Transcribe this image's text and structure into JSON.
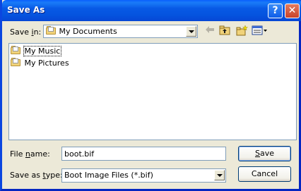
{
  "window": {
    "title": "Save As"
  },
  "titlebar": {
    "help_label": "?",
    "close_label": "✕"
  },
  "save_in": {
    "label_pre": "Save ",
    "label_key": "i",
    "label_post": "n:",
    "value": "My Documents"
  },
  "toolbar": {
    "back_icon": "back-arrow-icon",
    "up_icon": "up-folder-icon",
    "new_folder_icon": "new-folder-icon",
    "views_icon": "views-menu-icon"
  },
  "files": [
    {
      "name": "My Music",
      "icon": "folder-icon",
      "focused": true
    },
    {
      "name": "My Pictures",
      "icon": "folder-icon",
      "focused": false
    }
  ],
  "file_name": {
    "label_pre": "File ",
    "label_key": "n",
    "label_post": "ame:",
    "value": "boot.bif"
  },
  "save_as_type": {
    "label_pre": "Save as ",
    "label_key": "t",
    "label_post": "ype:",
    "value": "Boot Image Files (*.bif)"
  },
  "buttons": {
    "save_key": "S",
    "save_rest": "ave",
    "cancel": "Cancel"
  }
}
